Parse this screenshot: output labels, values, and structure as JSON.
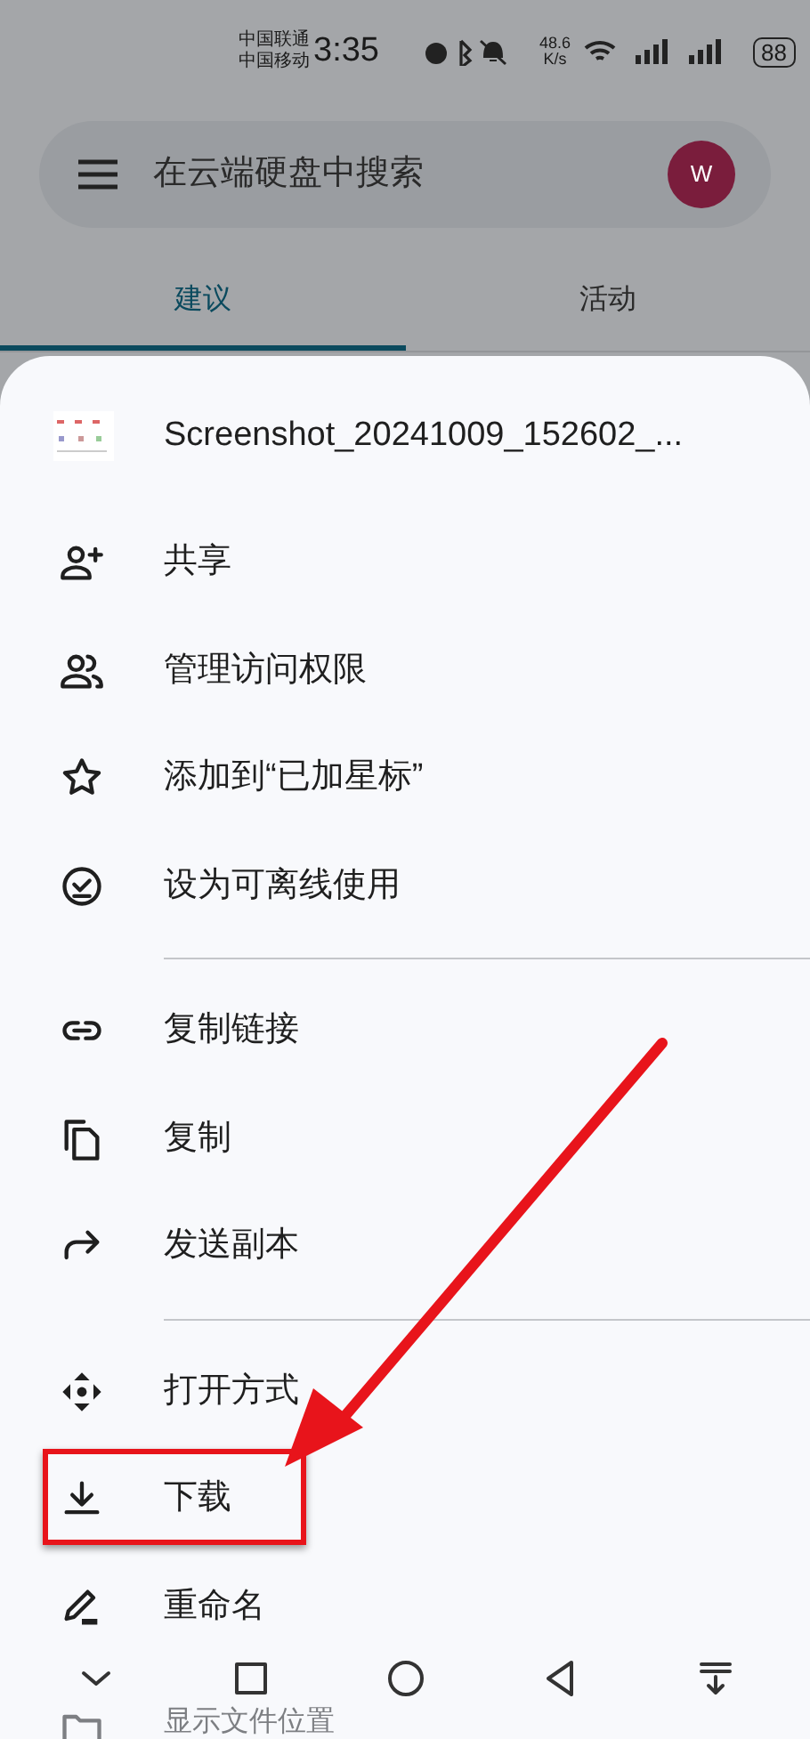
{
  "status_bar": {
    "carriers": [
      "中国联通",
      "中国移动"
    ],
    "time": "3:35",
    "speed": "48.6",
    "speed_unit": "K/s",
    "battery": "88"
  },
  "search": {
    "placeholder": "在云端硬盘中搜索",
    "avatar": "W"
  },
  "tabs": [
    {
      "label": "建议",
      "selected": true
    },
    {
      "label": "活动",
      "selected": false
    }
  ],
  "sheet": {
    "file_name": "Screenshot_20241009_152602_...",
    "groups": [
      [
        {
          "kind": "share",
          "label": "共享",
          "highlighted": false,
          "faded": false
        },
        {
          "kind": "access",
          "label": "管理访问权限",
          "highlighted": false,
          "faded": false
        },
        {
          "kind": "starred",
          "label": "添加到“已加星标”",
          "highlighted": false,
          "faded": false
        },
        {
          "kind": "offline",
          "label": "设为可离线使用",
          "highlighted": false,
          "faded": false
        }
      ],
      [
        {
          "kind": "link",
          "label": "复制链接",
          "highlighted": false,
          "faded": false
        },
        {
          "kind": "copy",
          "label": "复制",
          "highlighted": false,
          "faded": false
        },
        {
          "kind": "send",
          "label": "发送副本",
          "highlighted": false,
          "faded": false
        }
      ],
      [
        {
          "kind": "open",
          "label": "打开方式",
          "highlighted": false,
          "faded": false
        },
        {
          "kind": "download",
          "label": "下载",
          "highlighted": true,
          "faded": false
        },
        {
          "kind": "rename",
          "label": "重命名",
          "highlighted": false,
          "faded": false
        },
        {
          "kind": "location",
          "label": "显示文件位置",
          "highlighted": false,
          "faded": true
        }
      ]
    ]
  }
}
